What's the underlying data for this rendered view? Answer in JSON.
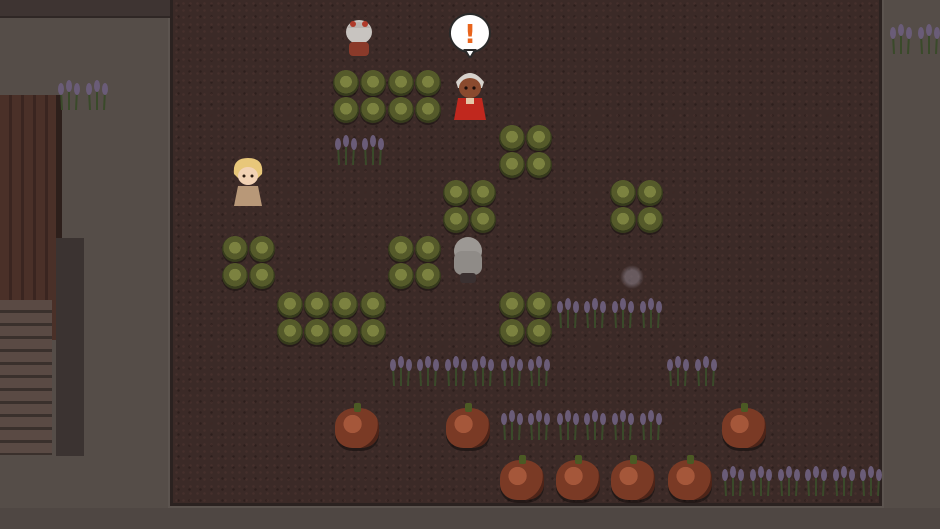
{
  "scene": {
    "type": "rpg-farm-field-at-night",
    "colors": {
      "soil": "#3b2a27",
      "path": "#5c544f",
      "cabbage": "#555a2a",
      "lavender": "#6a5c78",
      "pumpkin": "#7a3a25",
      "emote": "#e8641c"
    }
  },
  "emote": {
    "text": "!",
    "icon": "exclamation-balloon-icon"
  },
  "characters": [
    {
      "name": "farmer-back-view",
      "icon": "npc-icon"
    },
    {
      "name": "red-robe-villager",
      "icon": "npc-icon"
    },
    {
      "name": "blonde-child",
      "icon": "npc-icon"
    },
    {
      "name": "player-gray-hair",
      "icon": "player-icon"
    }
  ],
  "crops": {
    "cabbage": "cabbage-icon",
    "lavender": "lavender-icon",
    "pumpkin": "pumpkin-icon"
  }
}
